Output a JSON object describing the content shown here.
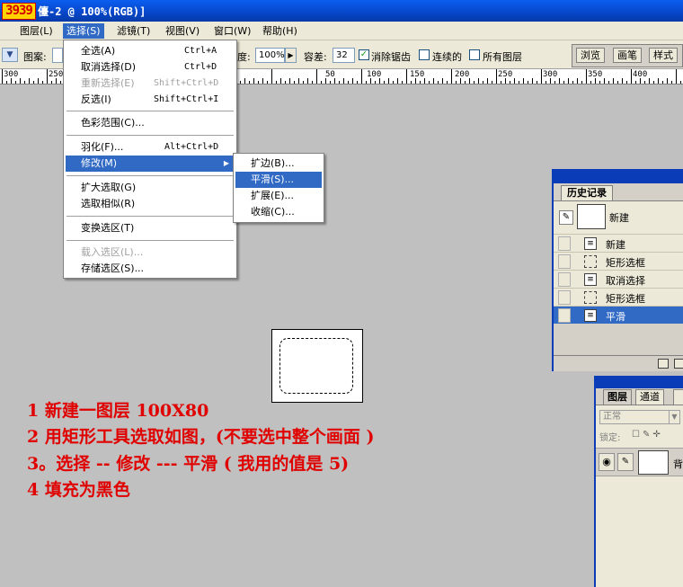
{
  "window": {
    "logo": "3939",
    "title": "儓-2 @ 100%(RGB)]"
  },
  "menubar": {
    "items": [
      {
        "label": "图层(L)"
      },
      {
        "label": "选择(S)"
      },
      {
        "label": "滤镜(T)"
      },
      {
        "label": "视图(V)"
      },
      {
        "label": "窗口(W)"
      },
      {
        "label": "帮助(H)"
      }
    ]
  },
  "options": {
    "pattern_label": "图案:",
    "opacity_suffix": "度:",
    "opacity_value": "100%",
    "tolerance_label": "容差:",
    "tolerance_value": "32",
    "antialias_label": "消除锯齿",
    "contiguous_label": "连续的",
    "all_layers_label": "所有图层",
    "palette_tabs": [
      "浏览",
      "画笔",
      "样式"
    ]
  },
  "ruler": {
    "labels": [
      "300",
      "250",
      "50",
      "100",
      "150",
      "200",
      "250",
      "300",
      "350",
      "400"
    ]
  },
  "select_menu": {
    "items": [
      {
        "label": "全选(A)",
        "shortcut": "Ctrl+A"
      },
      {
        "label": "取消选择(D)",
        "shortcut": "Ctrl+D"
      },
      {
        "label": "重新选择(E)",
        "shortcut": "Shift+Ctrl+D"
      },
      {
        "label": "反选(I)",
        "shortcut": "Shift+Ctrl+I"
      },
      {
        "label": "色彩范围(C)..."
      },
      {
        "label": "羽化(F)...",
        "shortcut": "Alt+Ctrl+D"
      },
      {
        "label": "修改(M)"
      },
      {
        "label": "扩大选取(G)"
      },
      {
        "label": "选取相似(R)"
      },
      {
        "label": "变换选区(T)"
      },
      {
        "label": "载入选区(L)..."
      },
      {
        "label": "存储选区(S)..."
      }
    ]
  },
  "modify_submenu": {
    "items": [
      {
        "label": "扩边(B)..."
      },
      {
        "label": "平滑(S)..."
      },
      {
        "label": "扩展(E)..."
      },
      {
        "label": "收缩(C)..."
      }
    ]
  },
  "instructions": [
    "1 新建一图层 100X80",
    "2 用矩形工具选取如图，(不要选中整个画面 )",
    "3。选择 -- 修改 --- 平滑 ( 我用的值是 5)",
    "4 填充为黑色"
  ],
  "history": {
    "tab": "历史记录",
    "snapshot_label": "新建",
    "rows": [
      {
        "label": "新建"
      },
      {
        "label": "矩形选框"
      },
      {
        "label": "取消选择"
      },
      {
        "label": "矩形选框"
      },
      {
        "label": "平滑"
      }
    ]
  },
  "layers": {
    "tabs": [
      "图层",
      "通道"
    ],
    "blend_mode": "正常",
    "lock_label": "锁定:",
    "layer_name": "背"
  }
}
